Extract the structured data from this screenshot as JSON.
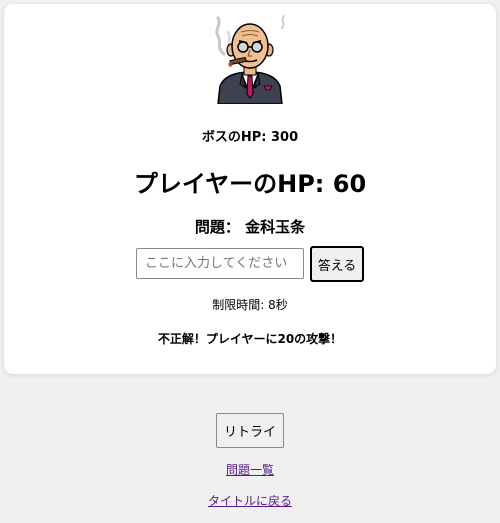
{
  "boss": {
    "image_icon": "bald-boss-with-cigar-icon",
    "hp_text": "ボスのHP: 300"
  },
  "player": {
    "hp_text": "プレイヤーのHP: 60"
  },
  "question": {
    "text": "問題： 金科玉条"
  },
  "answer": {
    "value": "",
    "placeholder": "ここに入力してください",
    "button_label": "答える"
  },
  "timer": {
    "text": "制限時間: 8秒"
  },
  "feedback": {
    "text": "不正解！プレイヤーに20の攻撃！"
  },
  "footer": {
    "retry_label": "リトライ",
    "list_link": "問題一覧",
    "title_link": "タイトルに戻る"
  },
  "colors": {
    "page_background": "#f0f0f0",
    "card_background": "#ffffff",
    "link": "#551a8b"
  }
}
